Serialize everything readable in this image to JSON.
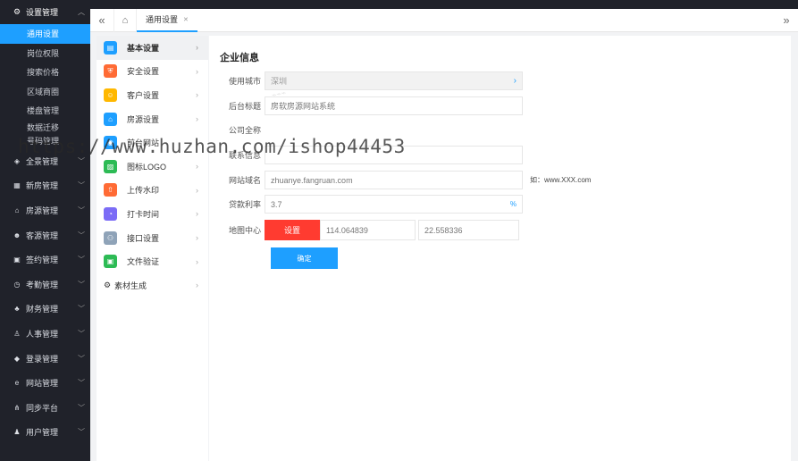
{
  "sidebar": {
    "group": {
      "label": "设置管理",
      "icon": "gear-icon"
    },
    "subitems": [
      {
        "label": "通用设置",
        "active": true
      },
      {
        "label": "岗位权限",
        "active": false
      },
      {
        "label": "搜索价格",
        "active": false
      },
      {
        "label": "区域商圈",
        "active": false
      },
      {
        "label": "楼盘管理",
        "active": false
      },
      {
        "label": "数据迁移",
        "active": false
      },
      {
        "label": "号码管理",
        "active": false
      }
    ],
    "items": [
      {
        "label": "全景管理",
        "icon": "layers-icon"
      },
      {
        "label": "新房管理",
        "icon": "building-icon"
      },
      {
        "label": "房源管理",
        "icon": "home-icon"
      },
      {
        "label": "客源管理",
        "icon": "users-icon"
      },
      {
        "label": "签约管理",
        "icon": "contract-icon"
      },
      {
        "label": "考勤管理",
        "icon": "clock-icon"
      },
      {
        "label": "财务管理",
        "icon": "finance-icon"
      },
      {
        "label": "人事管理",
        "icon": "org-icon"
      },
      {
        "label": "登录管理",
        "icon": "shield-icon"
      },
      {
        "label": "网站管理",
        "icon": "ie-icon"
      },
      {
        "label": "同步平台",
        "icon": "share-icon"
      },
      {
        "label": "用户管理",
        "icon": "user-icon"
      }
    ]
  },
  "tabbar": {
    "tab_label": "通用设置"
  },
  "menu": {
    "items": [
      {
        "label": "基本设置",
        "icon_color": "#1e9fff",
        "active": true
      },
      {
        "label": "安全设置",
        "icon_color": "#ff6b35",
        "active": false
      },
      {
        "label": "客户设置",
        "icon_color": "#ffb800",
        "active": false
      },
      {
        "label": "房源设置",
        "icon_color": "#1e9fff",
        "active": false
      },
      {
        "label": "前台网站",
        "icon_color": "#1e9fff",
        "active": false
      },
      {
        "label": "图标LOGO",
        "icon_color": "#2dbb55",
        "active": false
      },
      {
        "label": "上传水印",
        "icon_color": "#ff6b35",
        "active": false
      },
      {
        "label": "打卡时间",
        "icon_color": "#7b6cf6",
        "active": false
      },
      {
        "label": "接口设置",
        "icon_color": "#8fa3b8",
        "active": false
      },
      {
        "label": "文件验证",
        "icon_color": "#2dbb55",
        "active": false
      }
    ],
    "extra_label": "素材生成"
  },
  "form": {
    "title": "企业信息",
    "city_label": "使用城市",
    "city_value": "深圳",
    "backend_title_label": "后台标题",
    "backend_title_value": "房软房源网站系统",
    "company_label": "公司全称",
    "company_value": "",
    "contact_label": "联系信息",
    "contact_value": "",
    "domain_label": "网站域名",
    "domain_value": "zhuanye.fangruan.com",
    "domain_hint": "如：www.XXX.com",
    "rate_label": "贷款利率",
    "rate_value": "3.7",
    "rate_suffix": "%",
    "map_label": "地图中心",
    "map_set_button": "设置",
    "map_lng": "114.064839",
    "map_lat": "22.558336",
    "confirm_button": "确定"
  },
  "watermark": "https://www.huzhan.com/ishop44453",
  "colors": {
    "sidebar_bg": "#20222a",
    "accent": "#1e9fff",
    "danger": "#ff3b30"
  }
}
